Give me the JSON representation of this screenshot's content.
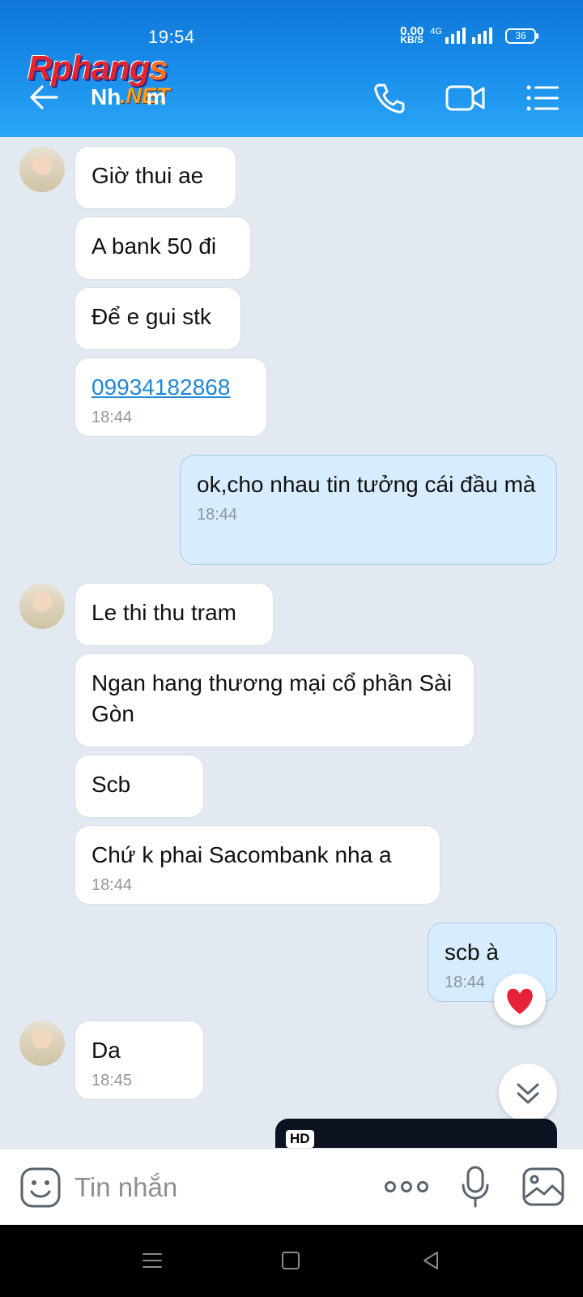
{
  "status_bar": {
    "time": "19:54",
    "net_speed_value": "0.00",
    "net_speed_unit": "KB/S",
    "network_type": "4G",
    "battery": "36"
  },
  "watermark": {
    "brand_prefix": "Rphang",
    "brand_suffix": "s",
    "brand_net": ".NET"
  },
  "header": {
    "title": "Nh    m",
    "icons": [
      "back-arrow-icon",
      "phone-icon",
      "video-call-icon",
      "menu-list-icon"
    ]
  },
  "messages": [
    {
      "direction": "in",
      "text": "Giờ thui ae"
    },
    {
      "direction": "in",
      "text": "A bank 50 đi"
    },
    {
      "direction": "in",
      "text": "Để e gui stk"
    },
    {
      "direction": "in",
      "text": "09934182868",
      "time": "18:44",
      "link": true
    },
    {
      "direction": "out",
      "text": "ok,cho nhau tin tưởng cái đầu mà",
      "time": "18:44"
    },
    {
      "direction": "in",
      "text": "Le thi thu tram"
    },
    {
      "direction": "in",
      "text": "Ngan hang thương mại cổ phần Sài Gòn"
    },
    {
      "direction": "in",
      "text": "Scb"
    },
    {
      "direction": "in",
      "text": "Chứ k phai Sacombank nha a",
      "time": "18:44"
    },
    {
      "direction": "out",
      "text": "scb à",
      "time": "18:44",
      "reaction": "heart"
    },
    {
      "direction": "in",
      "text": "Da",
      "time": "18:45"
    }
  ],
  "video_preview": {
    "badge": "HD"
  },
  "input": {
    "placeholder": "Tin nhắn",
    "value": ""
  },
  "colors": {
    "header": "#1a8fec",
    "incoming_bubble": "#ffffff",
    "outgoing_bubble": "#d7ecfd",
    "chat_bg": "#e2e9f1",
    "link": "#1f87d6",
    "heart": "#e8213a"
  }
}
